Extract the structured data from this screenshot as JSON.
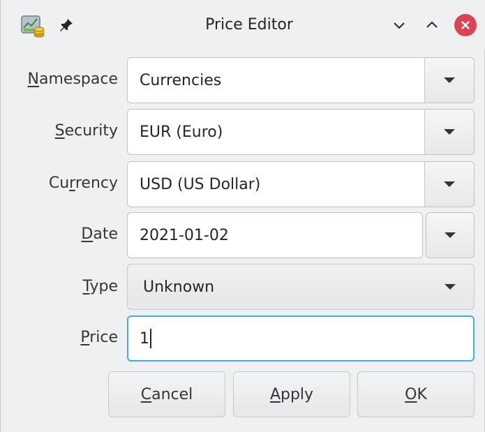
{
  "window": {
    "title": "Price Editor",
    "icons": [
      "app-icon",
      "pin-icon",
      "minimize-icon",
      "maximize-icon",
      "close-icon"
    ]
  },
  "form": {
    "namespace": {
      "label_u": "N",
      "label_rest": "amespace",
      "value": "Currencies"
    },
    "security": {
      "label_pre": "",
      "label_u": "S",
      "label_rest": "ecurity",
      "value": "EUR (Euro)"
    },
    "currency": {
      "label_pre": "Cu",
      "label_u": "r",
      "label_rest": "rency",
      "value": "USD (US Dollar)"
    },
    "date": {
      "label_u": "D",
      "label_rest": "ate",
      "value": "2021-01-02"
    },
    "type": {
      "label_u": "T",
      "label_rest": "ype",
      "value": "Unknown"
    },
    "price": {
      "label_u": "P",
      "label_rest": "rice",
      "value": "1"
    }
  },
  "buttons": {
    "cancel": {
      "u": "C",
      "rest": "ancel"
    },
    "apply": {
      "u": "A",
      "rest": "pply"
    },
    "ok": {
      "u": "O",
      "rest": "K"
    }
  },
  "colors": {
    "close": "#da4453",
    "focus": "#3daee9",
    "background": "#eff0f1"
  }
}
